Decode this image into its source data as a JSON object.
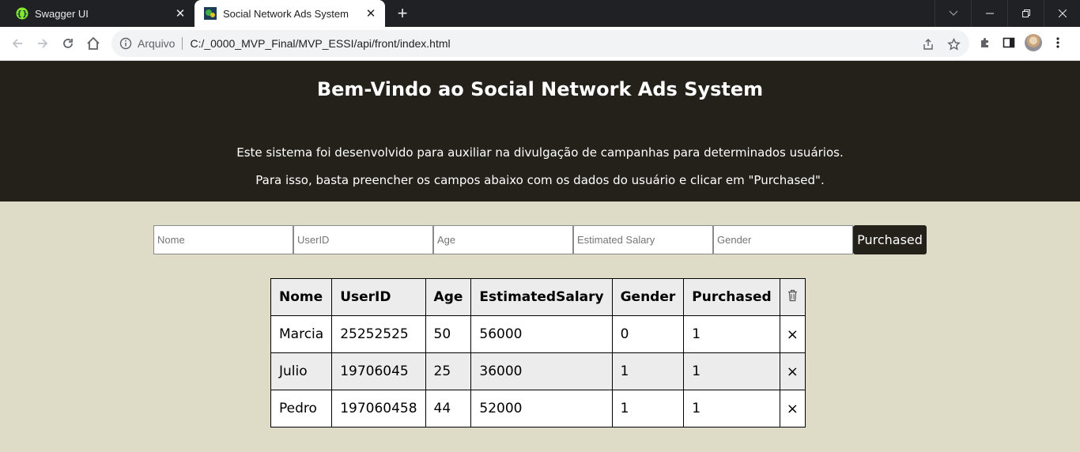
{
  "browser": {
    "tabs": [
      {
        "title": "Swagger UI",
        "active": false,
        "icon": "swagger-icon"
      },
      {
        "title": "Social Network Ads System",
        "active": true,
        "icon": "site-icon"
      }
    ],
    "new_tab_label": "+",
    "omnibox": {
      "scheme_label": "Arquivo",
      "url": "C:/_0000_MVP_Final/MVP_ESSI/api/front/index.html"
    }
  },
  "header": {
    "title": "Bem-Vindo ao Social Network Ads System",
    "line1": "Este sistema foi desenvolvido para auxiliar na divulgação de campanhas para determinados usuários.",
    "line2": "Para isso, basta preencher os campos abaixo com os dados do usuário e clicar em \"Purchased\"."
  },
  "form": {
    "placeholders": {
      "nome": "Nome",
      "userid": "UserID",
      "age": "Age",
      "salary": "Estimated Salary",
      "gender": "Gender"
    },
    "submit_label": "Purchased"
  },
  "table": {
    "headers": [
      "Nome",
      "UserID",
      "Age",
      "EstimatedSalary",
      "Gender",
      "Purchased"
    ],
    "delete_column_icon": "trash-icon",
    "delete_glyph": "×",
    "rows": [
      {
        "nome": "Marcia",
        "userid": "25252525",
        "age": "50",
        "salary": "56000",
        "gender": "0",
        "purchased": "1"
      },
      {
        "nome": "Julio",
        "userid": "19706045",
        "age": "25",
        "salary": "36000",
        "gender": "1",
        "purchased": "1"
      },
      {
        "nome": "Pedro",
        "userid": "197060458",
        "age": "44",
        "salary": "52000",
        "gender": "1",
        "purchased": "1"
      }
    ]
  }
}
